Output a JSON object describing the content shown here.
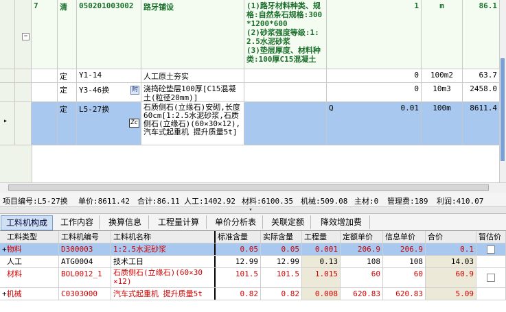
{
  "upper_rows": [
    {
      "no": "7",
      "type": "清",
      "code": "050201003002",
      "name": "路牙铺设",
      "features": "(1)路牙材料种类、规格:自然条石规格:300*1200*600\n(2)砂浆强度等级:1:2.5水泥砂浆\n(3)垫层厚度、材料种类:100厚C15混凝土",
      "unit": "m",
      "qty": "1",
      "price": "86.1"
    },
    {
      "type": "定",
      "code": "Y1-14",
      "name": "人工原土夯实",
      "qty": "0",
      "unit": "100m2",
      "price": "63.7"
    },
    {
      "type": "定",
      "code": "Y3-46换",
      "name": "浇捣砼垫层100厚[C15混凝土(粒径20mm)]",
      "badge": "附",
      "qty": "0",
      "unit": "10m3",
      "price": "2458.0"
    },
    {
      "type": "定",
      "code": "L5-27换",
      "name": "石质侧石(立缘石)安砌,长度60cm[1:2.5水泥砂浆,石质侧石(立缘石)(60×30×12),汽车式起重机 提升质量5t]",
      "badge": "Zc",
      "mark": "Q",
      "qty": "0.01",
      "unit": "100m",
      "price": "8611.4",
      "arrow": "▸"
    }
  ],
  "info": {
    "code": "项目编号:L5-27换",
    "unit_price": "单价:8611.42",
    "total": "合计:86.11",
    "labor": "人工:1402.92",
    "material": "材料:6100.35",
    "machine": "机械:509.08",
    "main_mat": "主材:0",
    "mgmt": "管理费:189",
    "profit": "利润:410.07"
  },
  "tabs": [
    "工料机构成",
    "工作内容",
    "换算信息",
    "工程量计算",
    "单价分析表",
    "关联定额",
    "降效增加费"
  ],
  "lower_headers": [
    "工料类型",
    "工料机编号",
    "工料机名称",
    "标准含量",
    "实际含量",
    "工程量",
    "定额单价",
    "信息单价",
    "合价",
    "暂估价"
  ],
  "lower_rows": [
    {
      "mk": "+",
      "type": "物料",
      "code": "D300003",
      "name": "1:2.5水泥砂浆",
      "std": "0.05",
      "act": "0.05",
      "qty": "0.001",
      "dp": "206.9",
      "ip": "206.9",
      "sum": "0.1",
      "color": "red",
      "sel": true
    },
    {
      "mk": "",
      "type": "人工",
      "code": "ATG0004",
      "name": "技术工日",
      "std": "12.99",
      "act": "12.99",
      "qty": "0.13",
      "dp": "108",
      "ip": "108",
      "sum": "14.03",
      "color": "black"
    },
    {
      "mk": "",
      "type": "材料",
      "code": "BOL0012_1",
      "name": "石质侧石(立缘石)(60×30\n×12)",
      "std": "101.5",
      "act": "101.5",
      "qty": "1.015",
      "dp": "60",
      "ip": "60",
      "sum": "60.9",
      "color": "red"
    },
    {
      "mk": "+",
      "type": "机械",
      "code": "C0303000",
      "name": "汽车式起重机 提升质量5t",
      "std": "0.82",
      "act": "0.82",
      "qty": "0.008",
      "dp": "620.83",
      "ip": "620.83",
      "sum": "5.09",
      "color": "red"
    }
  ],
  "colors": {
    "accent": "#a8c8f0",
    "qd_green": "#1a6e2a",
    "red": "#d00000"
  }
}
